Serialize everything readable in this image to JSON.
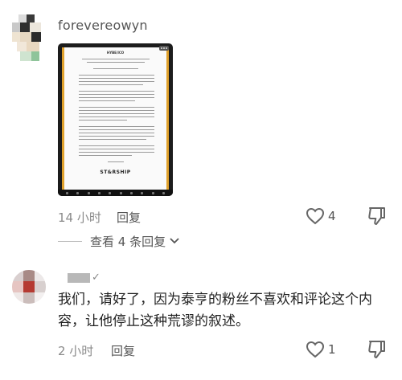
{
  "comment1": {
    "username": "forevereowyn",
    "attachment_title": "HYBE/ICO",
    "attachment_logo": "ST&RSHIP",
    "time": "14 小时",
    "reply_label": "回复",
    "likes": "4"
  },
  "view_more": {
    "label": "查看 4 条回复"
  },
  "comment2": {
    "username_suffix": "✓",
    "text": "我们，请好了，因为泰亨的粉丝不喜欢和评论这个内容，让他停止这种荒谬的叙述。",
    "time": "2 小时",
    "reply_label": "回复",
    "likes": "1"
  },
  "colors": {
    "accent_border": "#e0a12c",
    "meta_gray": "#8a8a8a"
  }
}
